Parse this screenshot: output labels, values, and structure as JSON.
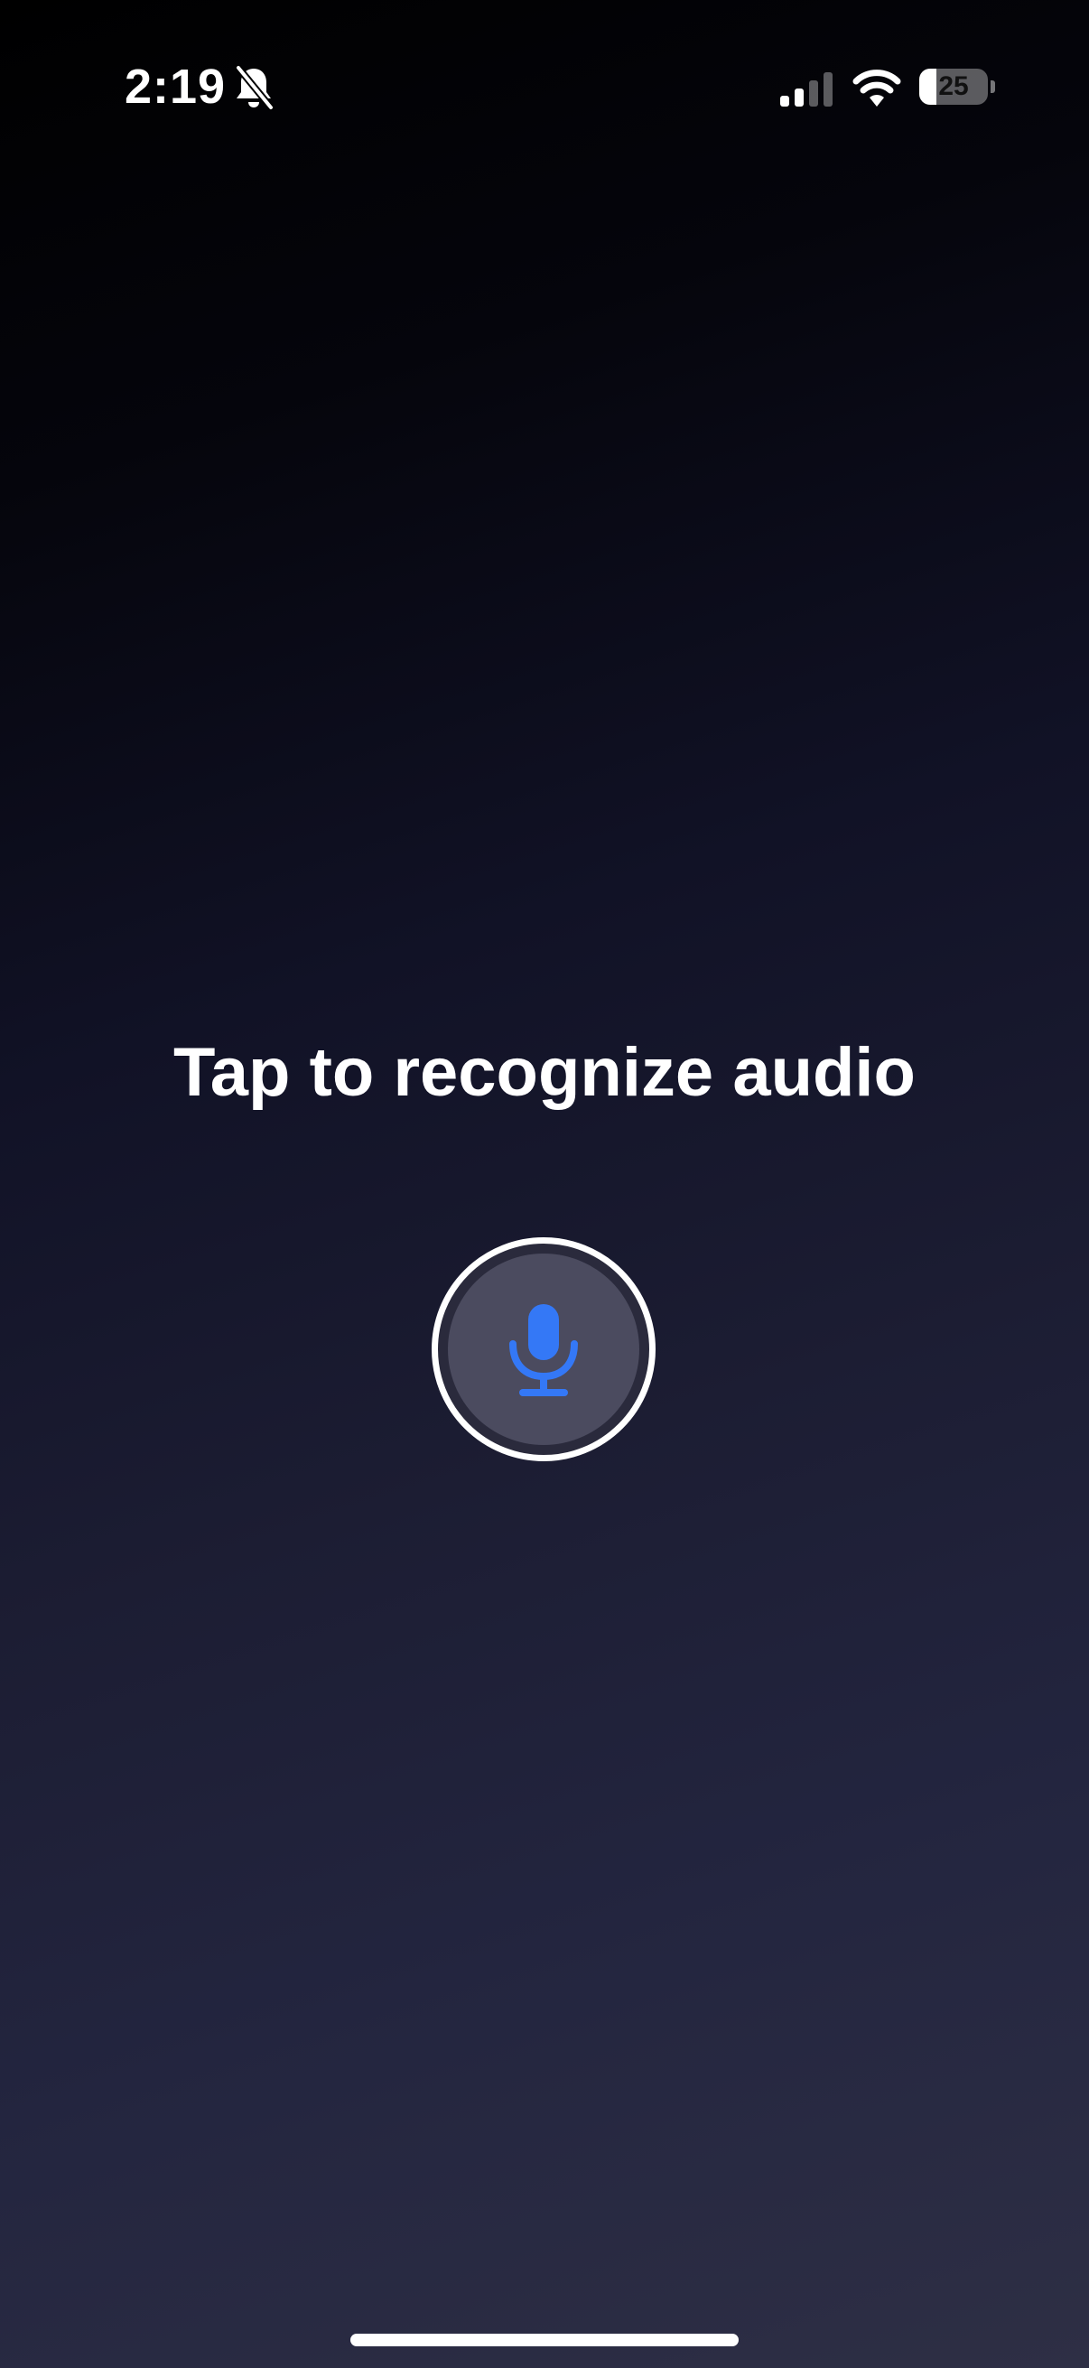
{
  "status_bar": {
    "time": "2:19",
    "silent_mode": true,
    "battery_level": "25",
    "battery_fraction": 0.25,
    "icons": [
      "bell-slash-icon",
      "cellular-signal-icon",
      "wifi-icon",
      "battery-icon"
    ]
  },
  "main": {
    "prompt": "Tap to recognize audio",
    "mic_button_icon": "microphone-icon",
    "accent_color": "#3478f6"
  }
}
